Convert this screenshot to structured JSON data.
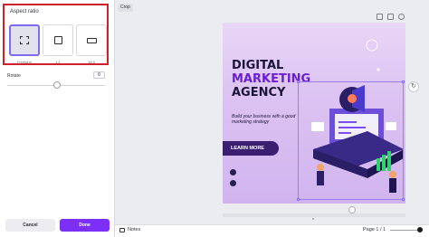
{
  "crop_panel": {
    "section_title": "Aspect ratio",
    "options": [
      {
        "label": "Freeform",
        "icon": "freeform-crop-icon",
        "selected": true
      },
      {
        "label": "1:1",
        "icon": "square-icon",
        "selected": false
      },
      {
        "label": "16:9",
        "icon": "widescreen-icon",
        "selected": false
      }
    ],
    "rotate_label": "Rotate",
    "rotate_value": "0",
    "cancel_label": "Cancel",
    "done_label": "Done"
  },
  "toolbar": {
    "crop_label": "Crop"
  },
  "design": {
    "title_lines": [
      "DIGITAL",
      "MARKETING",
      "AGENCY"
    ],
    "subtitle": "Build your business with a good marketing strategy",
    "cta_label": "LEARN MORE"
  },
  "footer": {
    "notes_label": "Notes",
    "page_indicator": "Page 1 / 1"
  },
  "colors": {
    "accent": "#7b2ff7",
    "highlight_border": "#d0202a",
    "title_purple": "#6a1fd1",
    "title_dark": "#1c1438"
  }
}
